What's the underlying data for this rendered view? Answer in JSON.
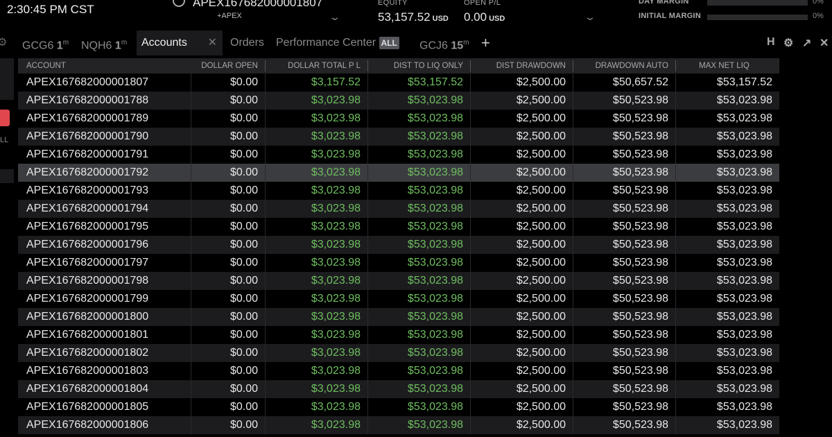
{
  "header": {
    "clock": "2:30:45 PM CST",
    "account": "APEX167682000001807",
    "account_sub": "+APEX",
    "equity_label": "EQUITY",
    "equity": "53,157.52",
    "equity_unit": "USD",
    "open_pl_label": "OPEN P/L",
    "open_pl": "0.00",
    "open_pl_unit": "USD",
    "day_margin_label": "DAY MARGIN",
    "day_margin_pct": "0%",
    "initial_margin_label": "INITIAL MARGIN",
    "initial_margin_pct": "0%"
  },
  "left": {
    "partial_label": "LL"
  },
  "tabs": [
    {
      "sym": "GCG6",
      "n": "1",
      "u": "m"
    },
    {
      "sym": "NQH6",
      "n": "1",
      "u": "m"
    },
    {
      "label": "Accounts"
    },
    {
      "label": "Orders"
    },
    {
      "label": "Performance Center",
      "badge": "ALL"
    },
    {
      "sym": "GCJ6",
      "n": "15",
      "u": "m"
    }
  ],
  "toolbar": {
    "h": "H"
  },
  "table": {
    "columns": [
      "ACCOUNT",
      "DOLLAR OPEN",
      "DOLLAR TOTAL P L",
      "DIST TO LIQ ONLY",
      "DIST DRAWDOWN",
      "DRAWDOWN AUTO",
      "MAX NET LIQ"
    ],
    "selected_row": "APEX167682000001792",
    "rows": [
      [
        "APEX167682000001807",
        "$0.00",
        "$3,157.52",
        "$53,157.52",
        "$2,500.00",
        "$50,657.52",
        "$53,157.52"
      ],
      [
        "APEX167682000001788",
        "$0.00",
        "$3,023.98",
        "$53,023.98",
        "$2,500.00",
        "$50,523.98",
        "$53,023.98"
      ],
      [
        "APEX167682000001789",
        "$0.00",
        "$3,023.98",
        "$53,023.98",
        "$2,500.00",
        "$50,523.98",
        "$53,023.98"
      ],
      [
        "APEX167682000001790",
        "$0.00",
        "$3,023.98",
        "$53,023.98",
        "$2,500.00",
        "$50,523.98",
        "$53,023.98"
      ],
      [
        "APEX167682000001791",
        "$0.00",
        "$3,023.98",
        "$53,023.98",
        "$2,500.00",
        "$50,523.98",
        "$53,023.98"
      ],
      [
        "APEX167682000001792",
        "$0.00",
        "$3,023.98",
        "$53,023.98",
        "$2,500.00",
        "$50,523.98",
        "$53,023.98"
      ],
      [
        "APEX167682000001793",
        "$0.00",
        "$3,023.98",
        "$53,023.98",
        "$2,500.00",
        "$50,523.98",
        "$53,023.98"
      ],
      [
        "APEX167682000001794",
        "$0.00",
        "$3,023.98",
        "$53,023.98",
        "$2,500.00",
        "$50,523.98",
        "$53,023.98"
      ],
      [
        "APEX167682000001795",
        "$0.00",
        "$3,023.98",
        "$53,023.98",
        "$2,500.00",
        "$50,523.98",
        "$53,023.98"
      ],
      [
        "APEX167682000001796",
        "$0.00",
        "$3,023.98",
        "$53,023.98",
        "$2,500.00",
        "$50,523.98",
        "$53,023.98"
      ],
      [
        "APEX167682000001797",
        "$0.00",
        "$3,023.98",
        "$53,023.98",
        "$2,500.00",
        "$50,523.98",
        "$53,023.98"
      ],
      [
        "APEX167682000001798",
        "$0.00",
        "$3,023.98",
        "$53,023.98",
        "$2,500.00",
        "$50,523.98",
        "$53,023.98"
      ],
      [
        "APEX167682000001799",
        "$0.00",
        "$3,023.98",
        "$53,023.98",
        "$2,500.00",
        "$50,523.98",
        "$53,023.98"
      ],
      [
        "APEX167682000001800",
        "$0.00",
        "$3,023.98",
        "$53,023.98",
        "$2,500.00",
        "$50,523.98",
        "$53,023.98"
      ],
      [
        "APEX167682000001801",
        "$0.00",
        "$3,023.98",
        "$53,023.98",
        "$2,500.00",
        "$50,523.98",
        "$53,023.98"
      ],
      [
        "APEX167682000001802",
        "$0.00",
        "$3,023.98",
        "$53,023.98",
        "$2,500.00",
        "$50,523.98",
        "$53,023.98"
      ],
      [
        "APEX167682000001803",
        "$0.00",
        "$3,023.98",
        "$53,023.98",
        "$2,500.00",
        "$50,523.98",
        "$53,023.98"
      ],
      [
        "APEX167682000001804",
        "$0.00",
        "$3,023.98",
        "$53,023.98",
        "$2,500.00",
        "$50,523.98",
        "$53,023.98"
      ],
      [
        "APEX167682000001805",
        "$0.00",
        "$3,023.98",
        "$53,023.98",
        "$2,500.00",
        "$50,523.98",
        "$53,023.98"
      ],
      [
        "APEX167682000001806",
        "$0.00",
        "$3,023.98",
        "$53,023.98",
        "$2,500.00",
        "$50,523.98",
        "$53,023.98"
      ]
    ]
  },
  "colors": {
    "positive": "#6fbf5f",
    "selected_row": "#3b3c40",
    "sell": "#e0474c"
  }
}
